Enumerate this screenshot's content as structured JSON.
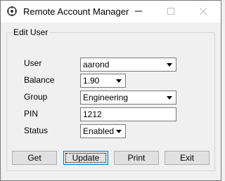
{
  "window": {
    "title": "Remote Account Manager"
  },
  "group": {
    "legend": "Edit User"
  },
  "fields": {
    "user": {
      "label": "User",
      "value": "aarond"
    },
    "balance": {
      "label": "Balance",
      "value": "1.90"
    },
    "group": {
      "label": "Group",
      "value": "Engineering"
    },
    "pin": {
      "label": "PIN",
      "value": "1212"
    },
    "status": {
      "label": "Status",
      "value": "Enabled"
    }
  },
  "buttons": {
    "get": "Get",
    "update": "Update",
    "print": "Print",
    "exit": "Exit"
  },
  "icons": {
    "app": "app-icon",
    "minimize": "minimize-icon",
    "maximize": "maximize-icon",
    "close": "close-icon",
    "dropdown": "chevron-down-icon"
  }
}
